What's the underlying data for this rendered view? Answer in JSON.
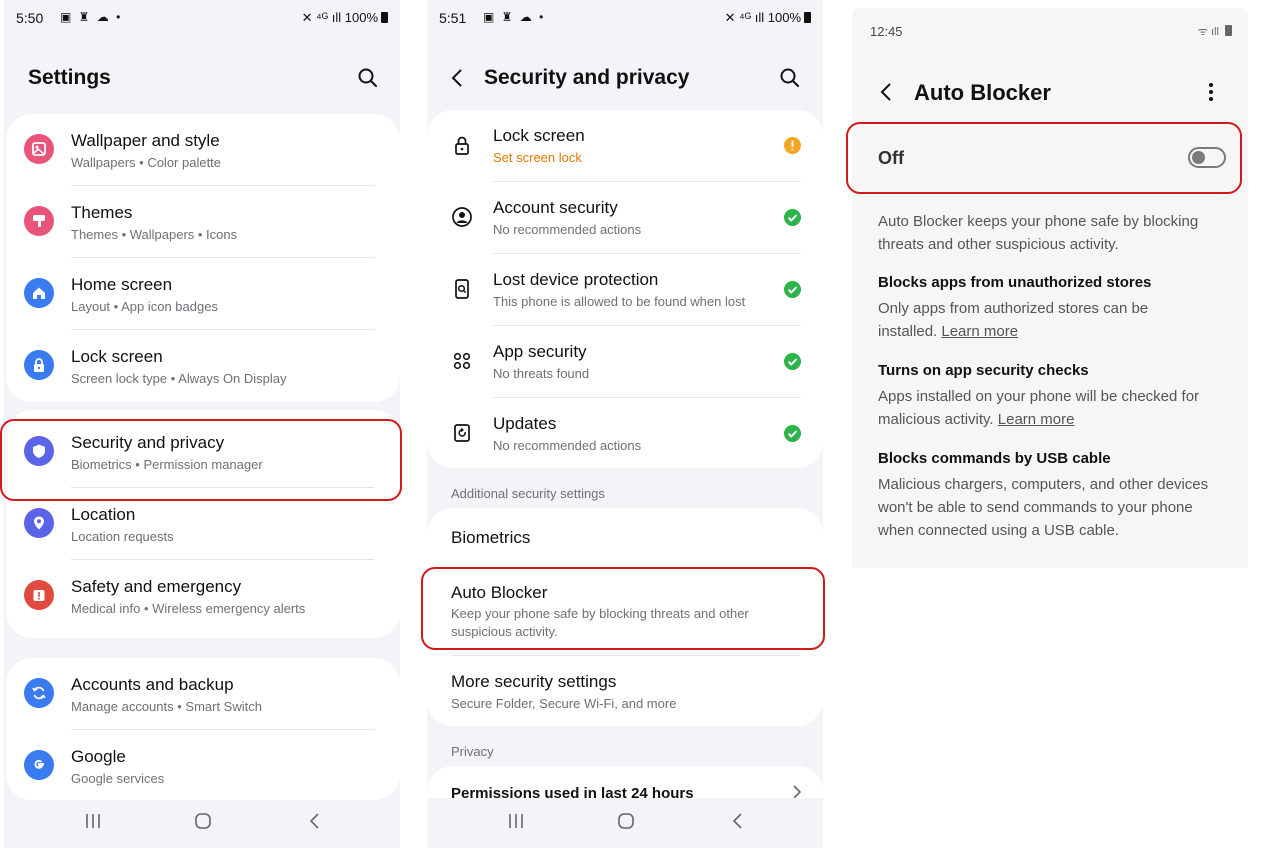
{
  "colors": {
    "highlight": "#d11a1a",
    "warning": "#f5a623",
    "ok": "#2cb34a",
    "warning_text": "#e07b00",
    "toggle_off": "#7a7a7a"
  },
  "screen1": {
    "status": {
      "time": "5:50",
      "battery": "100%"
    },
    "title": "Settings",
    "search_icon": "search-icon",
    "card1": [
      {
        "label": "Wallpaper and style",
        "sub": "Wallpapers  •  Color palette",
        "icon": "wallpaper-icon",
        "color": "#e9557a"
      },
      {
        "label": "Themes",
        "sub": "Themes  •  Wallpapers  •  Icons",
        "icon": "themes-icon",
        "color": "#e9557a"
      },
      {
        "label": "Home screen",
        "sub": "Layout  •  App icon badges",
        "icon": "home-icon",
        "color": "#3a7bf0"
      },
      {
        "label": "Lock screen",
        "sub": "Screen lock type  •  Always On Display",
        "icon": "lock-icon",
        "color": "#3a7bf0"
      }
    ],
    "card2": [
      {
        "label": "Security and privacy",
        "sub": "Biometrics  •  Permission manager",
        "icon": "shield-icon",
        "color": "#5b63e6"
      },
      {
        "label": "Location",
        "sub": "Location requests",
        "icon": "location-pin-icon",
        "color": "#5b63e6"
      },
      {
        "label": "Safety and emergency",
        "sub": "Medical info  •  Wireless emergency alerts",
        "icon": "emergency-icon",
        "color": "#e04a3f"
      }
    ],
    "card3": [
      {
        "label": "Accounts and backup",
        "sub": "Manage accounts  •  Smart Switch",
        "icon": "sync-icon",
        "color": "#3a7bf0"
      },
      {
        "label": "Google",
        "sub": "Google services",
        "icon": "google-icon",
        "color": "#3a7bf0"
      }
    ]
  },
  "screen2": {
    "status": {
      "time": "5:51",
      "battery": "100%"
    },
    "title": "Security and privacy",
    "items": [
      {
        "label": "Lock screen",
        "sub": "Set screen lock",
        "icon": "lock-icon",
        "status": "warning"
      },
      {
        "label": "Account security",
        "sub": "No recommended actions",
        "icon": "account-icon",
        "status": "ok"
      },
      {
        "label": "Lost device protection",
        "sub": "This phone is allowed to be found when lost",
        "icon": "find-device-icon",
        "status": "ok"
      },
      {
        "label": "App security",
        "sub": "No threats found",
        "icon": "apps-icon",
        "status": "ok"
      },
      {
        "label": "Updates",
        "sub": "No recommended actions",
        "icon": "update-icon",
        "status": "ok"
      }
    ],
    "additional_header": "Additional security settings",
    "biometrics": "Biometrics",
    "auto_blocker": {
      "label": "Auto Blocker",
      "sub": "Keep your phone safe by blocking threats and other suspicious activity."
    },
    "more_security": {
      "label": "More security settings",
      "sub": "Secure Folder, Secure Wi-Fi, and more"
    },
    "privacy_header": "Privacy",
    "permissions": "Permissions used in last 24 hours"
  },
  "screen3": {
    "status": {
      "time": "12:45"
    },
    "title": "Auto Blocker",
    "toggle_label": "Off",
    "toggle_state": "off",
    "intro": "Auto Blocker keeps your phone safe by blocking threats and other suspicious activity.",
    "features": [
      {
        "heading": "Blocks apps from unauthorized stores",
        "body": "Only apps from authorized stores can be installed.",
        "link": "Learn more"
      },
      {
        "heading": "Turns on app security checks",
        "body": "Apps installed on your phone will be checked for malicious activity.",
        "link": "Learn more"
      },
      {
        "heading": "Blocks commands by USB cable",
        "body": "Malicious chargers, computers, and other devices won't be able to send commands to your phone when connected using a USB cable.",
        "link": ""
      }
    ]
  }
}
